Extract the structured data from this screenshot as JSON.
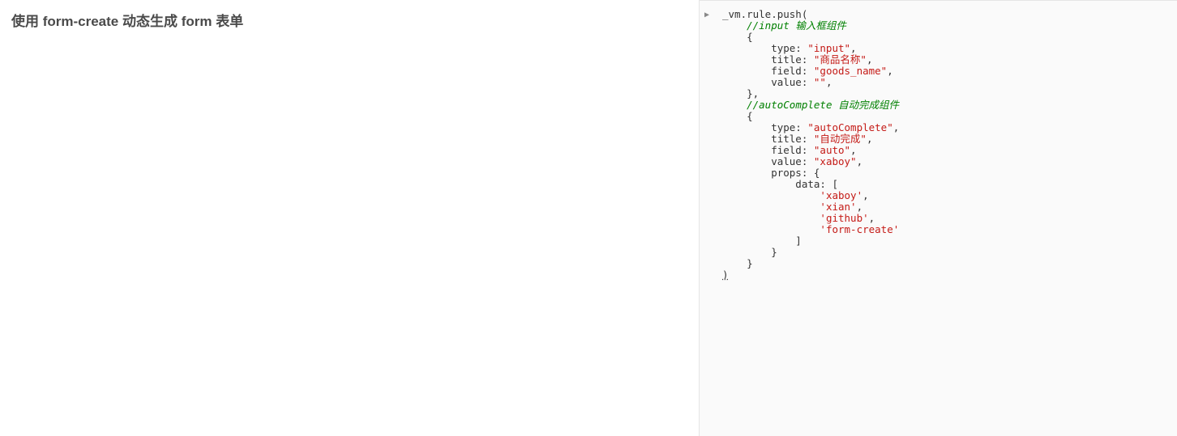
{
  "leftPanel": {
    "title": "使用 form-create 动态生成 form 表单"
  },
  "rightPanel": {
    "expandArrow": "▶",
    "lines": [
      {
        "tokens": [
          {
            "cls": "tok-default",
            "t": "_vm.rule.push("
          }
        ]
      },
      {
        "tokens": [
          {
            "cls": "tok-default",
            "t": "    "
          },
          {
            "cls": "tok-comment",
            "t": "//input 输入框组件"
          }
        ]
      },
      {
        "tokens": [
          {
            "cls": "tok-default",
            "t": "    {"
          }
        ]
      },
      {
        "tokens": [
          {
            "cls": "tok-default",
            "t": "        type: "
          },
          {
            "cls": "tok-string",
            "t": "\"input\""
          },
          {
            "cls": "tok-default",
            "t": ","
          }
        ]
      },
      {
        "tokens": [
          {
            "cls": "tok-default",
            "t": "        title: "
          },
          {
            "cls": "tok-string",
            "t": "\"商品名称\""
          },
          {
            "cls": "tok-default",
            "t": ","
          }
        ]
      },
      {
        "tokens": [
          {
            "cls": "tok-default",
            "t": "        field: "
          },
          {
            "cls": "tok-string",
            "t": "\"goods_name\""
          },
          {
            "cls": "tok-default",
            "t": ","
          }
        ]
      },
      {
        "tokens": [
          {
            "cls": "tok-default",
            "t": "        value: "
          },
          {
            "cls": "tok-string",
            "t": "\"\""
          },
          {
            "cls": "tok-default",
            "t": ","
          }
        ]
      },
      {
        "tokens": [
          {
            "cls": "tok-default",
            "t": "    },"
          }
        ]
      },
      {
        "tokens": [
          {
            "cls": "tok-default",
            "t": "    "
          },
          {
            "cls": "tok-comment",
            "t": "//autoComplete 自动完成组件"
          }
        ]
      },
      {
        "tokens": [
          {
            "cls": "tok-default",
            "t": "    {"
          }
        ]
      },
      {
        "tokens": [
          {
            "cls": "tok-default",
            "t": "        type: "
          },
          {
            "cls": "tok-string",
            "t": "\"autoComplete\""
          },
          {
            "cls": "tok-default",
            "t": ","
          }
        ]
      },
      {
        "tokens": [
          {
            "cls": "tok-default",
            "t": "        title: "
          },
          {
            "cls": "tok-string",
            "t": "\"自动完成\""
          },
          {
            "cls": "tok-default",
            "t": ","
          }
        ]
      },
      {
        "tokens": [
          {
            "cls": "tok-default",
            "t": "        field: "
          },
          {
            "cls": "tok-string",
            "t": "\"auto\""
          },
          {
            "cls": "tok-default",
            "t": ","
          }
        ]
      },
      {
        "tokens": [
          {
            "cls": "tok-default",
            "t": "        value: "
          },
          {
            "cls": "tok-string",
            "t": "\"xaboy\""
          },
          {
            "cls": "tok-default",
            "t": ","
          }
        ]
      },
      {
        "tokens": [
          {
            "cls": "tok-default",
            "t": "        props: {"
          }
        ]
      },
      {
        "tokens": [
          {
            "cls": "tok-default",
            "t": "            data: ["
          }
        ]
      },
      {
        "tokens": [
          {
            "cls": "tok-default",
            "t": "                "
          },
          {
            "cls": "tok-string",
            "t": "'xaboy'"
          },
          {
            "cls": "tok-default",
            "t": ","
          }
        ]
      },
      {
        "tokens": [
          {
            "cls": "tok-default",
            "t": "                "
          },
          {
            "cls": "tok-string",
            "t": "'xian'"
          },
          {
            "cls": "tok-default",
            "t": ","
          }
        ]
      },
      {
        "tokens": [
          {
            "cls": "tok-default",
            "t": "                "
          },
          {
            "cls": "tok-string",
            "t": "'github'"
          },
          {
            "cls": "tok-default",
            "t": ","
          }
        ]
      },
      {
        "tokens": [
          {
            "cls": "tok-default",
            "t": "                "
          },
          {
            "cls": "tok-string",
            "t": "'form-create'"
          }
        ]
      },
      {
        "tokens": [
          {
            "cls": "tok-default",
            "t": "            ]"
          }
        ]
      },
      {
        "tokens": [
          {
            "cls": "tok-default",
            "t": "        }"
          }
        ]
      },
      {
        "tokens": [
          {
            "cls": "tok-default",
            "t": "    }"
          }
        ]
      },
      {
        "tokens": [
          {
            "cls": "tok-default last-paren",
            "t": ")"
          }
        ]
      }
    ]
  }
}
